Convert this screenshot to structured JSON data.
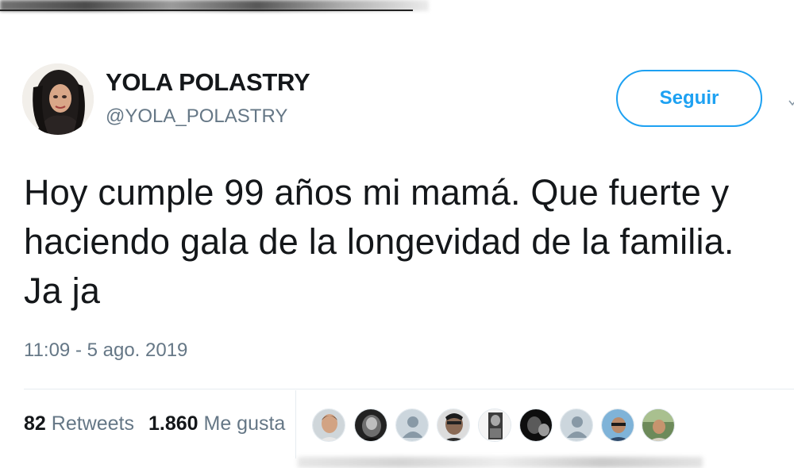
{
  "user": {
    "display_name": "YOLA POLASTRY",
    "handle": "@YOLA_POLASTRY",
    "avatar_icon": "profile-avatar-photo"
  },
  "follow_button": {
    "label": "Seguir",
    "color": "#1da1f2"
  },
  "more_icon": "chevron-down-icon",
  "tweet": {
    "text_line1": "Hoy cumple 99 años mi mamá. Que fuerte y",
    "text_line2": "haciendo gala de la longevidad de la familia.",
    "text_line3": "Ja ja",
    "timestamp": "11:09 - 5 ago. 2019"
  },
  "stats": {
    "retweets_count": "82",
    "retweets_label": "Retweets",
    "likes_count": "1.860",
    "likes_label": "Me gusta"
  },
  "likers": [
    {
      "name": "liker-avatar-1",
      "type": "photo"
    },
    {
      "name": "liker-avatar-2",
      "type": "photo"
    },
    {
      "name": "liker-avatar-3",
      "type": "default"
    },
    {
      "name": "liker-avatar-4",
      "type": "photo"
    },
    {
      "name": "liker-avatar-5",
      "type": "photo"
    },
    {
      "name": "liker-avatar-6",
      "type": "photo"
    },
    {
      "name": "liker-avatar-7",
      "type": "default"
    },
    {
      "name": "liker-avatar-8",
      "type": "photo"
    },
    {
      "name": "liker-avatar-9",
      "type": "photo"
    }
  ]
}
